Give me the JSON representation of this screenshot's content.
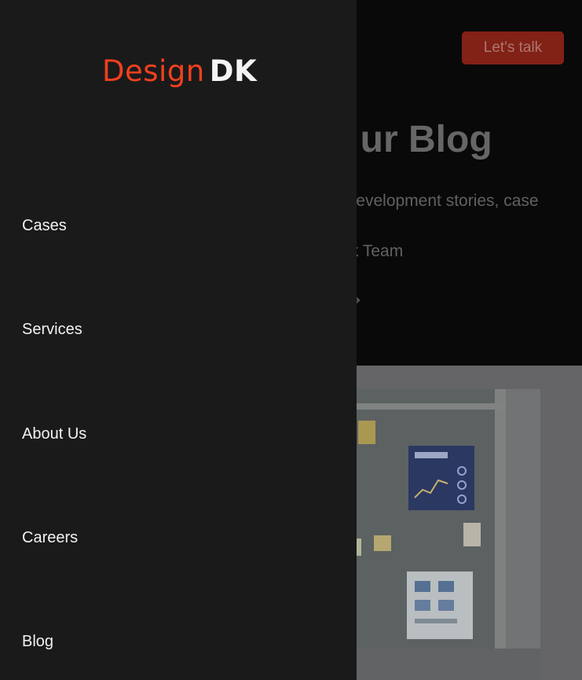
{
  "header": {
    "cta_label": "Let's talk"
  },
  "hero": {
    "title_visible": "ur Blog",
    "subtitle_visible": "development stories, case",
    "author_visible": "gnDk Team"
  },
  "drawer": {
    "logo": {
      "part_a": "Design",
      "part_b": "DK"
    },
    "nav_items": [
      {
        "label": "Cases"
      },
      {
        "label": "Services"
      },
      {
        "label": "About Us"
      },
      {
        "label": "Careers"
      },
      {
        "label": "Blog"
      }
    ]
  },
  "colors": {
    "brand_accent": "#f0401f",
    "drawer_bg": "#1a1a1a",
    "cta_bg": "#8e2418"
  }
}
